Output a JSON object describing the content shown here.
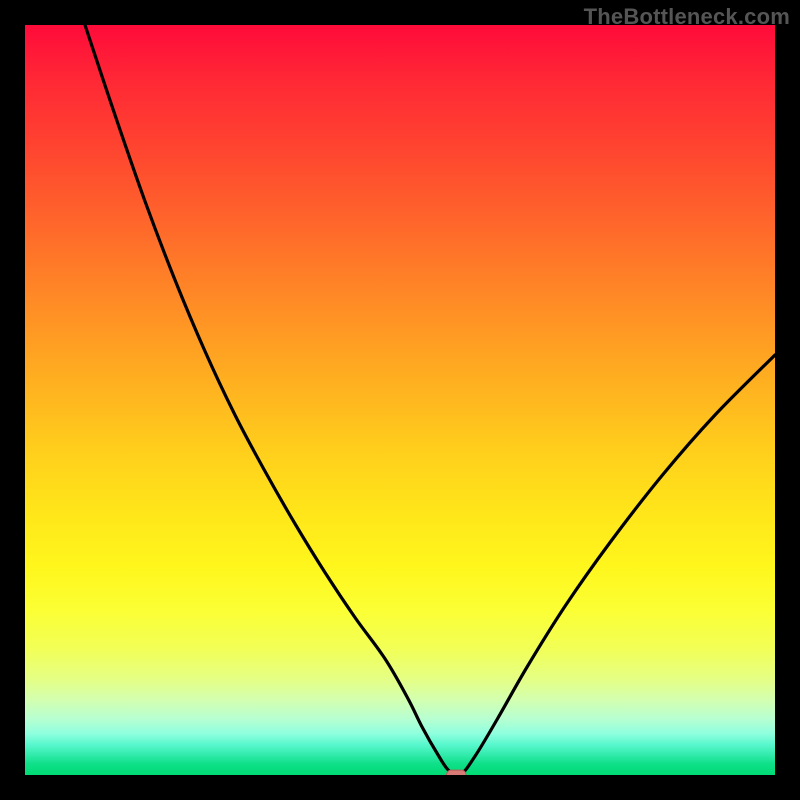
{
  "watermark": "TheBottleneck.com",
  "chart_data": {
    "type": "line",
    "title": "",
    "xlabel": "",
    "ylabel": "",
    "xlim": [
      0,
      100
    ],
    "ylim": [
      0,
      100
    ],
    "background_gradient": {
      "orientation": "vertical",
      "stops": [
        {
          "pos": 0.0,
          "color": "#ff0b3a"
        },
        {
          "pos": 0.5,
          "color": "#ffb120"
        },
        {
          "pos": 0.8,
          "color": "#f8ff40"
        },
        {
          "pos": 1.0,
          "color": "#00db74"
        }
      ]
    },
    "series": [
      {
        "name": "bottleneck-curve",
        "color": "#000000",
        "x": [
          8,
          12,
          16,
          20,
          24,
          28,
          32,
          36,
          40,
          44,
          48,
          51,
          53,
          55,
          56.5,
          58,
          60,
          63,
          67,
          72,
          78,
          85,
          92,
          100
        ],
        "y": [
          100,
          88,
          76.5,
          66,
          56.5,
          48,
          40.5,
          33.5,
          27,
          21,
          15.5,
          10.3,
          6.3,
          2.8,
          0.6,
          0.0,
          2.5,
          7.5,
          14.5,
          22.5,
          31.0,
          40.0,
          48.0,
          56.0
        ]
      }
    ],
    "marker": {
      "x": 57.5,
      "y": 0.0,
      "color": "#d87a76",
      "shape": "rounded-rect"
    },
    "grid": false,
    "legend": false
  }
}
